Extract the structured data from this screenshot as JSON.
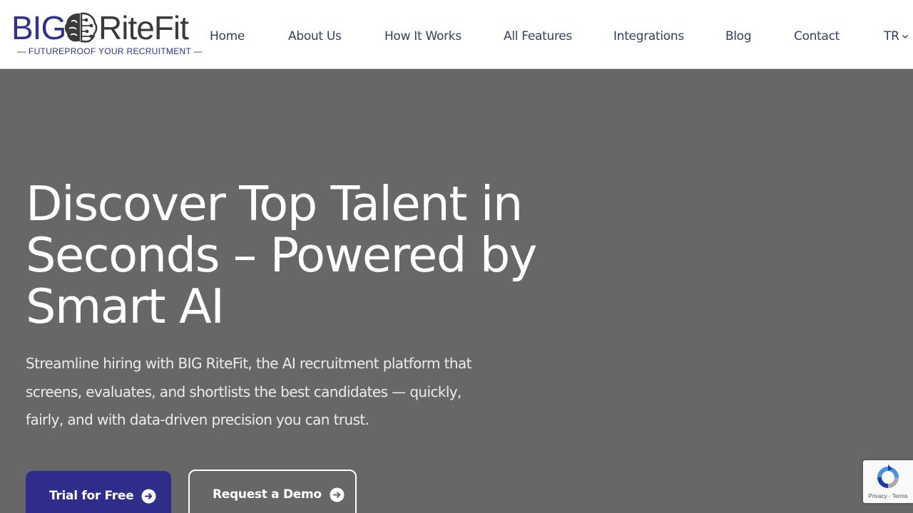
{
  "brand": {
    "logo_left": "BIG",
    "logo_right": "RiteFit",
    "tagline": "— FUTUREPROOF YOUR RECRUITMENT —"
  },
  "nav": {
    "items": [
      {
        "label": "Home"
      },
      {
        "label": "About Us"
      },
      {
        "label": "How It Works"
      },
      {
        "label": "All Features"
      },
      {
        "label": "Integrations"
      },
      {
        "label": "Blog"
      },
      {
        "label": "Contact"
      }
    ],
    "language": "TR",
    "language_icon": "chevron-down-icon"
  },
  "hero": {
    "title": "Discover Top Talent in Seconds – Powered by Smart AI",
    "subtitle": "Streamline hiring with BIG RiteFit, the AI recruitment platform that screens, evaluates, and shortlists the best candidates — quickly, fairly, and with data-driven precision you can trust.",
    "primary_cta": "Trial for Free",
    "secondary_cta": "Request a Demo",
    "cta_icon": "arrow-right-circle-icon"
  },
  "recaptcha": {
    "privacy": "Privacy",
    "separator": " - ",
    "terms": "Terms"
  },
  "colors": {
    "brand_blue": "#2e3190",
    "hero_bg": "#676767",
    "nav_text": "#33415c",
    "button_primary": "#2f2d8a"
  }
}
